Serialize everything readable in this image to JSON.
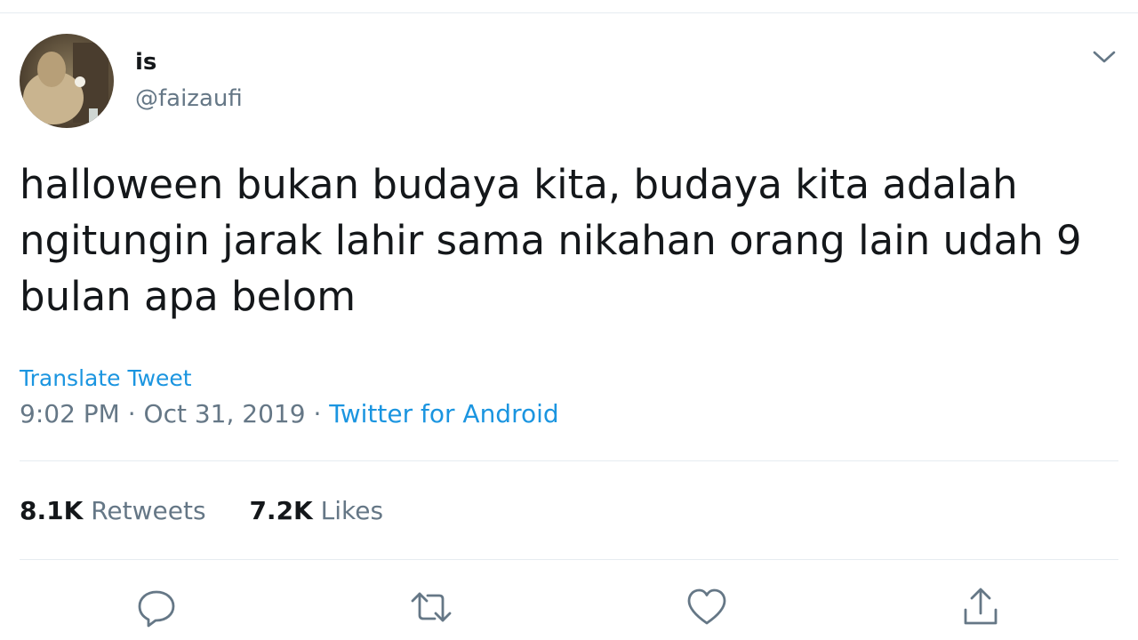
{
  "user": {
    "display_name": "is",
    "handle": "@faizaufi"
  },
  "tweet": {
    "text": "halloween bukan budaya kita, budaya kita adalah\nngitungin jarak lahir sama nikahan orang lain udah 9\nbulan apa belom",
    "translate_label": "Translate Tweet",
    "time": "9:02 PM",
    "date": "Oct 31, 2019",
    "separator": "·",
    "source": "Twitter for Android"
  },
  "stats": {
    "retweets_count": "8.1K",
    "retweets_label": "Retweets",
    "likes_count": "7.2K",
    "likes_label": "Likes"
  },
  "icons": {
    "caret": "chevron-down-icon",
    "reply": "reply-icon",
    "retweet": "retweet-icon",
    "like": "heart-icon",
    "share": "share-icon"
  },
  "colors": {
    "text": "#14171a",
    "secondary": "#657786",
    "link": "#1b95e0",
    "divider": "#e6ecf0"
  }
}
